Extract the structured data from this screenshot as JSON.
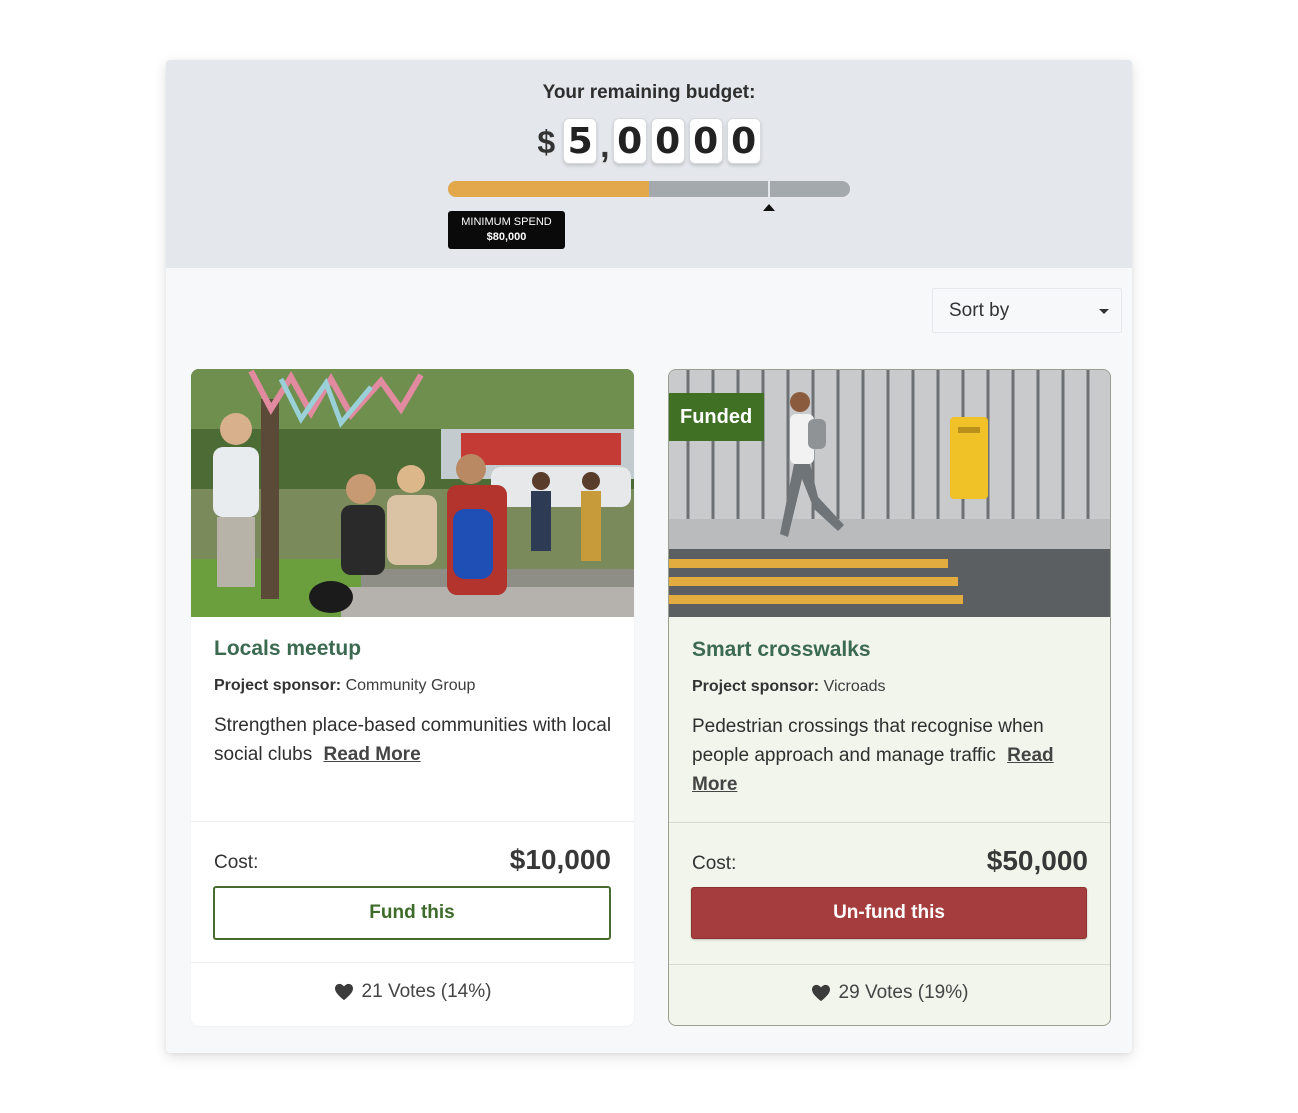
{
  "budget": {
    "title": "Your remaining budget:",
    "currency_symbol": "$",
    "digits": [
      "5",
      "0",
      "0",
      "0",
      "0"
    ],
    "separator": ",",
    "progress_fraction": 0.5,
    "minimum_spend_label": "MINIMUM SPEND",
    "minimum_spend_amount": "$80,000",
    "colors": {
      "fill": "#e3a84b",
      "track": "#a4a9ae"
    }
  },
  "sort": {
    "label": "Sort by"
  },
  "projects": [
    {
      "title": "Locals meetup",
      "sponsor_label": "Project sponsor:",
      "sponsor_name": "Community Group",
      "description": "Strengthen place-based communities with local social clubs",
      "read_more": "Read More",
      "cost_label": "Cost:",
      "cost": "$10,000",
      "button_label": "Fund this",
      "votes": "21 Votes (14%)",
      "funded": false
    },
    {
      "title": "Smart crosswalks",
      "sponsor_label": "Project sponsor:",
      "sponsor_name": "Vicroads",
      "description": "Pedestrian crossings that recognise when people approach and manage traffic",
      "read_more": "Read More",
      "cost_label": "Cost:",
      "cost": "$50,000",
      "button_label": "Un-fund this",
      "votes": "29 Votes (19%)",
      "funded": true,
      "badge": "Funded"
    }
  ],
  "colors": {
    "title_green": "#3c6a51",
    "funded_green": "#3f7023",
    "unfund_red": "#a53d3e"
  }
}
